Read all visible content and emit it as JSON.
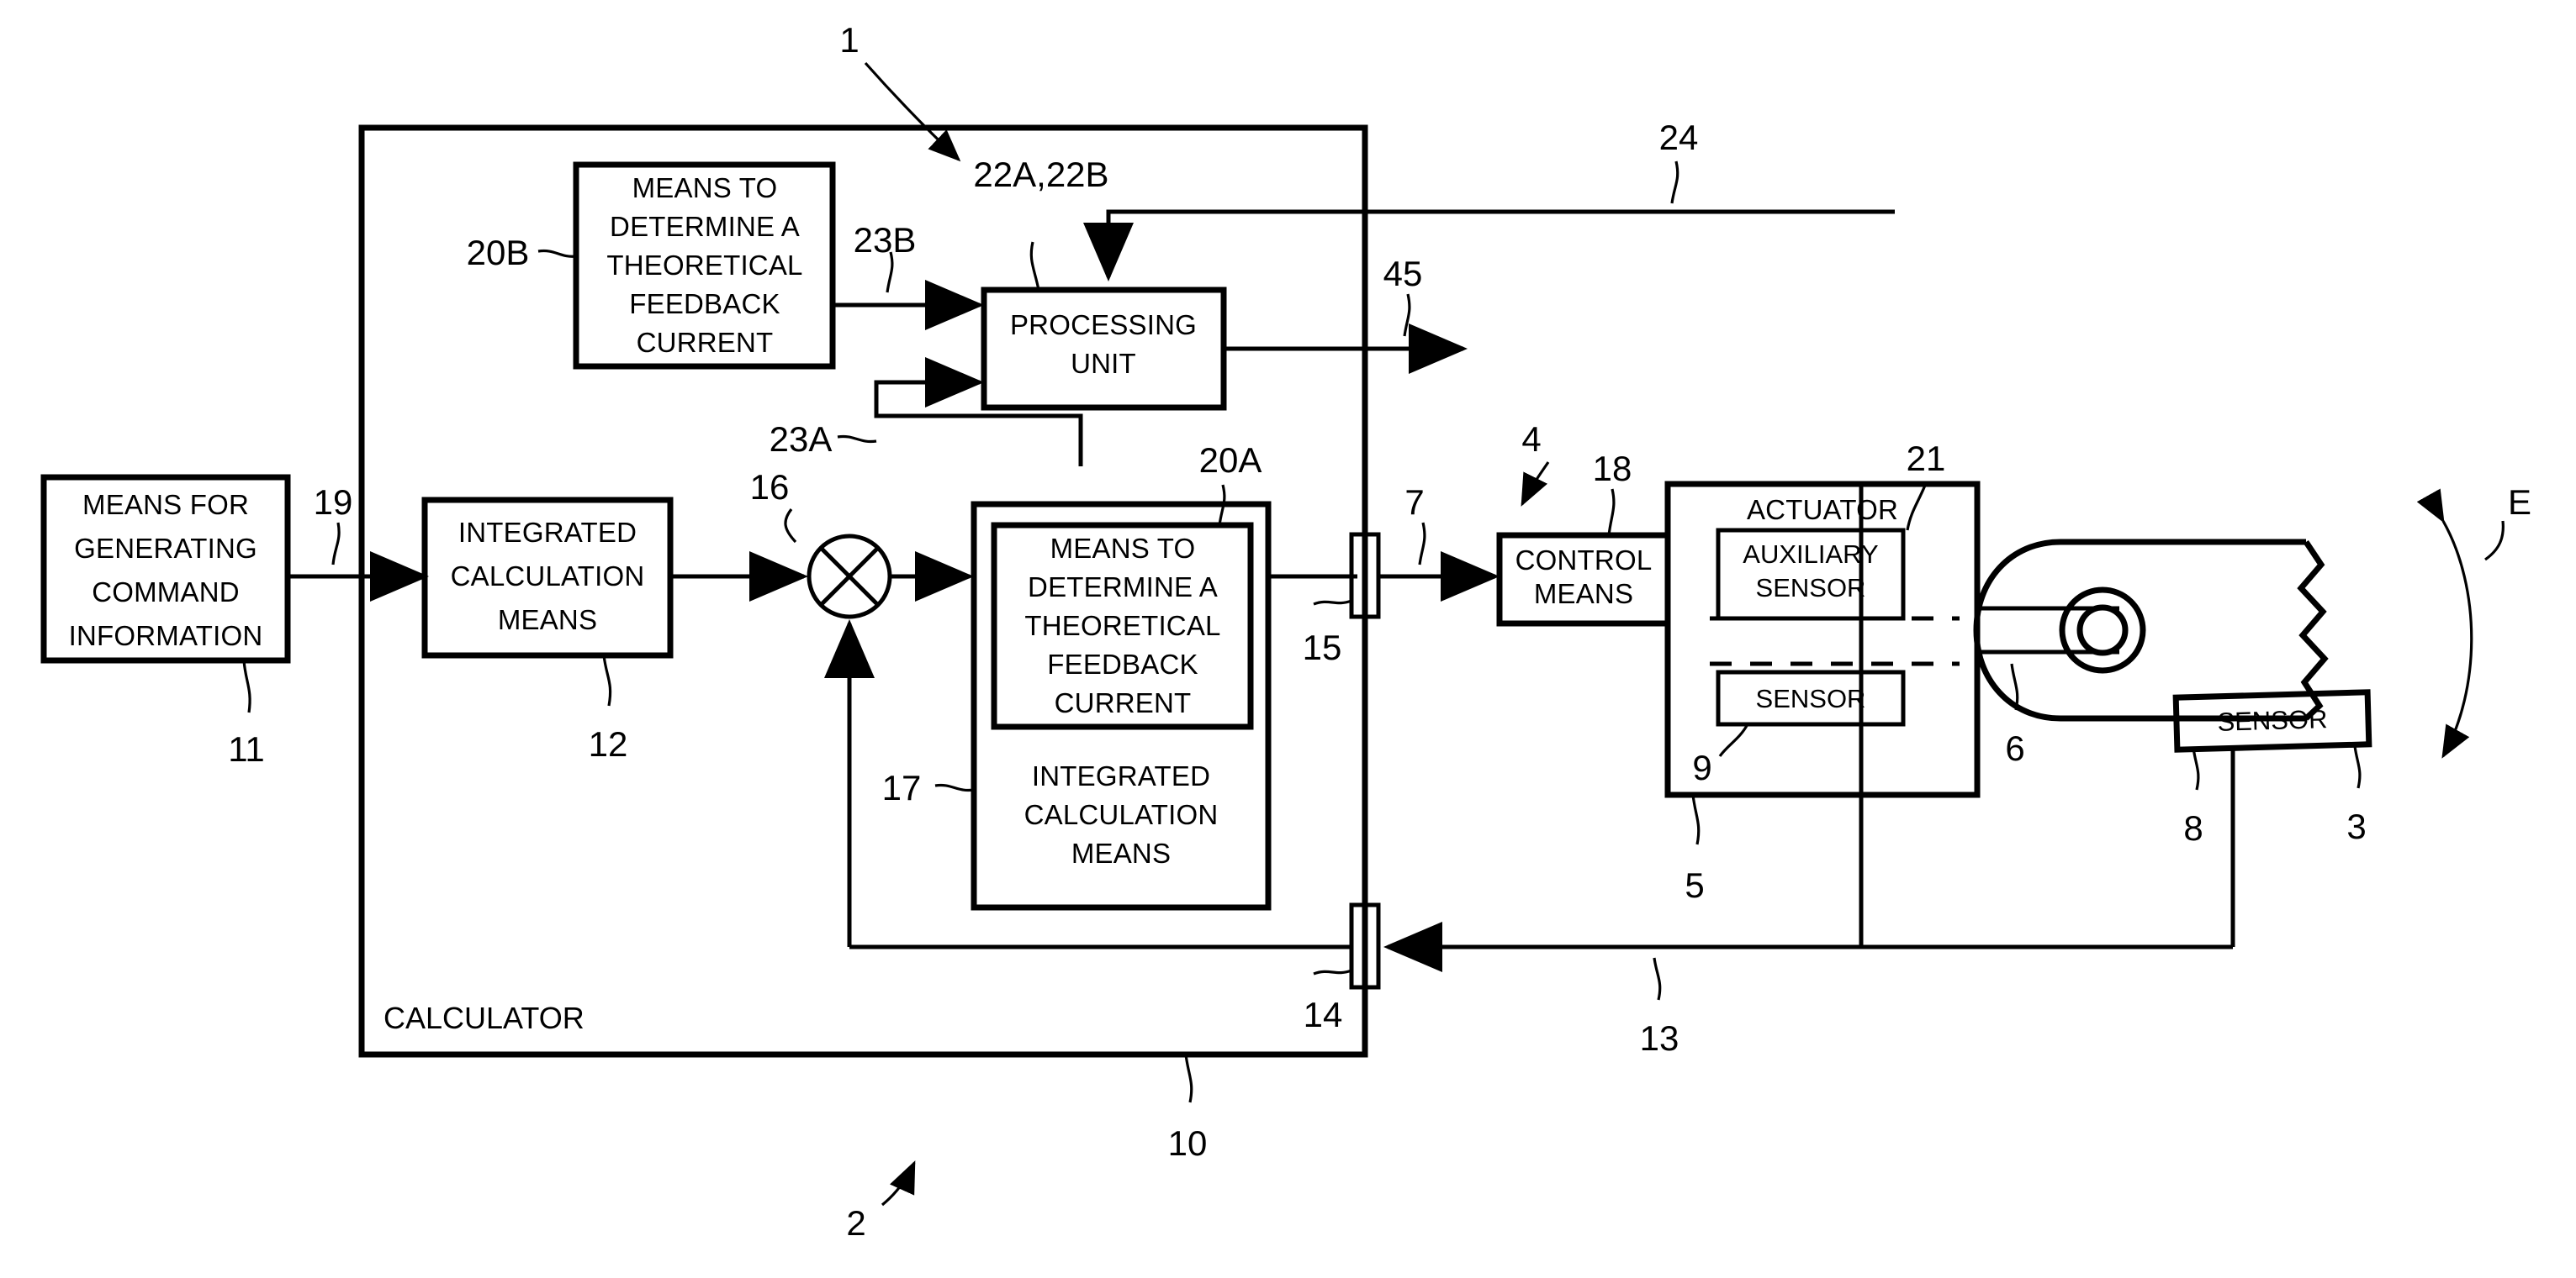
{
  "figure": {
    "title": "CALCULATOR",
    "domain": "patent block diagram"
  },
  "blocks": {
    "calculator": {
      "label": "CALCULATOR"
    },
    "means_generating_command": {
      "lines": [
        "MEANS FOR",
        "GENERATING",
        "COMMAND",
        "INFORMATION"
      ]
    },
    "integrated_calculation_means_12": {
      "lines": [
        "INTEGRATED",
        "CALCULATION",
        "MEANS"
      ]
    },
    "means_determine_theoretical_feedback_current_20b": {
      "lines": [
        "MEANS TO",
        "DETERMINE A",
        "THEORETICAL",
        "FEEDBACK",
        "CURRENT"
      ]
    },
    "processing_unit": {
      "lines": [
        "PROCESSING",
        "UNIT"
      ]
    },
    "means_determine_theoretical_feedback_current_20a": {
      "lines": [
        "MEANS TO",
        "DETERMINE A",
        "THEORETICAL",
        "FEEDBACK",
        "CURRENT"
      ]
    },
    "integrated_calculation_means_17": {
      "lines": [
        "INTEGRATED",
        "CALCULATION",
        "MEANS"
      ]
    },
    "control_means": {
      "lines": [
        "CONTROL",
        "MEANS"
      ]
    },
    "actuator": {
      "label": "ACTUATOR"
    },
    "auxiliary_sensor": {
      "lines": [
        "AUXILIARY",
        "SENSOR"
      ]
    },
    "sensor_9": {
      "label": "SENSOR"
    },
    "sensor_8": {
      "label": "SENSOR"
    }
  },
  "reference_numerals": {
    "n1": "1",
    "n2": "2",
    "n3": "3",
    "n4": "4",
    "n5": "5",
    "n6": "6",
    "n7": "7",
    "n8": "8",
    "n9": "9",
    "n10": "10",
    "n11": "11",
    "n12": "12",
    "n13": "13",
    "n14": "14",
    "n15": "15",
    "n16": "16",
    "n17": "17",
    "n18": "18",
    "n19": "19",
    "n20a": "20A",
    "n20b": "20B",
    "n21": "21",
    "n22ab": "22A,22B",
    "n23a": "23A",
    "n23b": "23B",
    "n24": "24",
    "n45": "45",
    "nE": "E"
  },
  "colors": {
    "line": "#000000",
    "background": "#ffffff"
  }
}
